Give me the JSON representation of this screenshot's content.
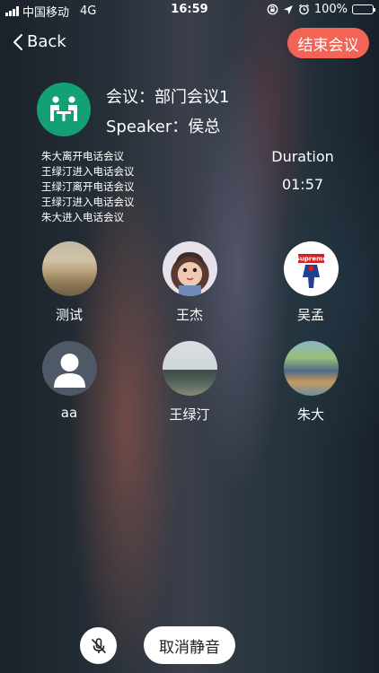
{
  "status_bar": {
    "carrier": "中国移动",
    "network": "4G",
    "time": "16:59",
    "battery": "100%",
    "icons": [
      "signal-icon",
      "rotation-lock-icon",
      "location-icon",
      "alarm-icon",
      "battery-icon"
    ]
  },
  "nav": {
    "back_label": "Back",
    "end_label": "结束会议"
  },
  "meeting": {
    "title": "会议：部门会议1",
    "speaker": "Speaker：侯总",
    "events": [
      "朱大离开电话会议",
      "王绿汀进入电话会议",
      "王绿汀离开电话会议",
      "王绿汀进入电话会议",
      "朱大进入电话会议"
    ],
    "duration_label": "Duration",
    "duration_value": "01:57"
  },
  "participants": [
    {
      "name": "测试",
      "avatar": "photo-avatar"
    },
    {
      "name": "王杰",
      "avatar": "anime-avatar"
    },
    {
      "name": "吴孟",
      "avatar": "supreme-avatar"
    },
    {
      "name": "aa",
      "avatar": "default-person-avatar"
    },
    {
      "name": "王绿汀",
      "avatar": "landscape-avatar"
    },
    {
      "name": "朱大",
      "avatar": "game-avatar"
    }
  ],
  "controls": {
    "mic_icon": "mic-muted-icon",
    "unmute_label": "取消静音"
  },
  "colors": {
    "end_button": "#f26456",
    "meeting_icon": "#13a074"
  }
}
